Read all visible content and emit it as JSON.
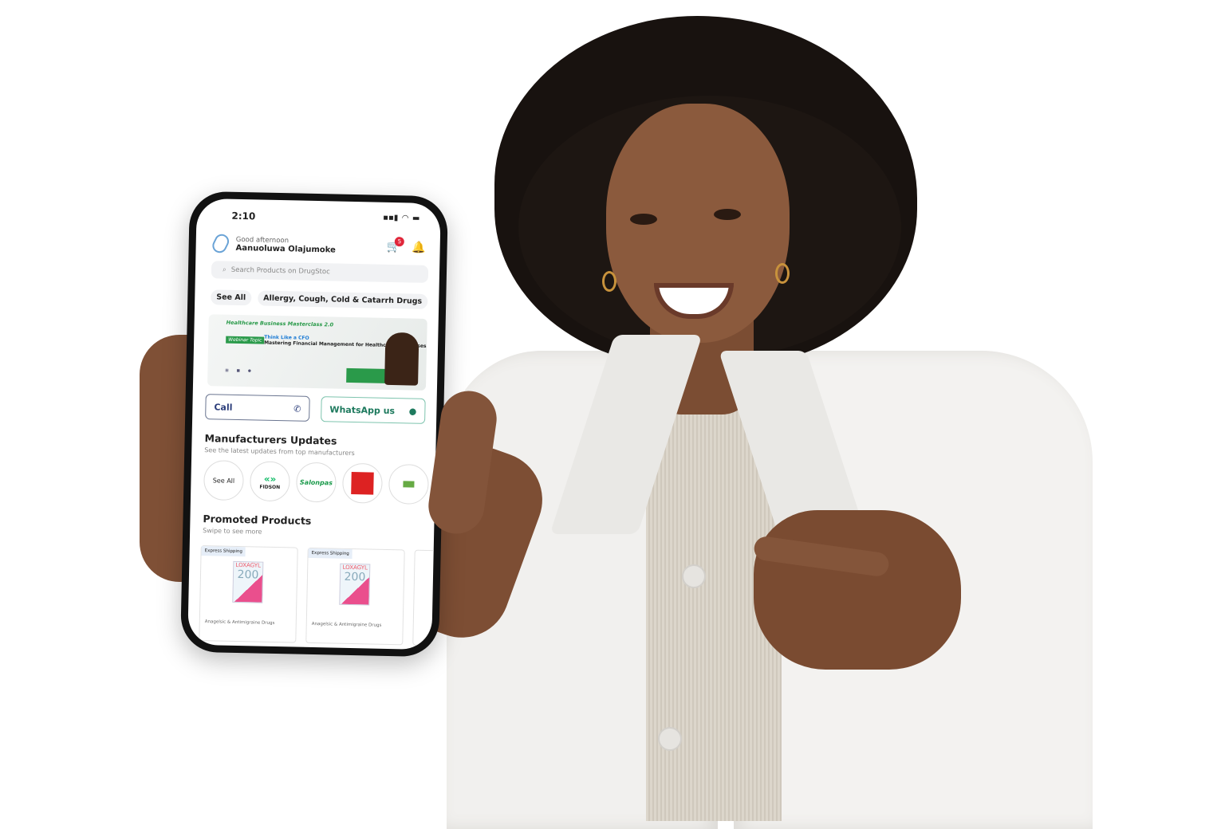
{
  "status_bar": {
    "time": "2:10",
    "signal": "signal-icon",
    "wifi": "wifi-icon",
    "battery": "battery-icon"
  },
  "header": {
    "greeting": "Good afternoon",
    "user_name": "Aanuoluwa Olajumoke",
    "cart_count": "5"
  },
  "search": {
    "placeholder": "Search Products on DrugStoc"
  },
  "categories": {
    "see_all": "See All",
    "items": [
      "Allergy, Cough, Cold & Catarrh Drugs"
    ]
  },
  "banner": {
    "title": "Healthcare Business Masterclass 2.0",
    "tag": "Webinar Topic",
    "headline": "Think Like a CFO",
    "subtitle": "Mastering Financial Management for Healthcare Businesses"
  },
  "actions": {
    "call": "Call",
    "whatsapp": "WhatsApp us"
  },
  "manufacturers": {
    "title": "Manufacturers Updates",
    "subtitle": "See the latest updates from top manufacturers",
    "see_all": "See All",
    "items": [
      "FIDSON",
      "Salonpas"
    ]
  },
  "promoted": {
    "title": "Promoted Products",
    "subtitle": "Swipe to see more",
    "products": [
      {
        "badge": "Express Shipping",
        "brand": "LOXAGYL",
        "strength": "200",
        "category": "Anagelsic & Antimigraine Drugs"
      },
      {
        "badge": "Express Shipping",
        "brand": "LOXAGYL",
        "strength": "200",
        "category": "Anagelsic & Antimigraine Drugs"
      }
    ]
  },
  "colors": {
    "badge": "#e0263a",
    "call": "#2b3d7a",
    "whatsapp": "#1e7a5e",
    "banner_green": "#2a9a4a"
  }
}
